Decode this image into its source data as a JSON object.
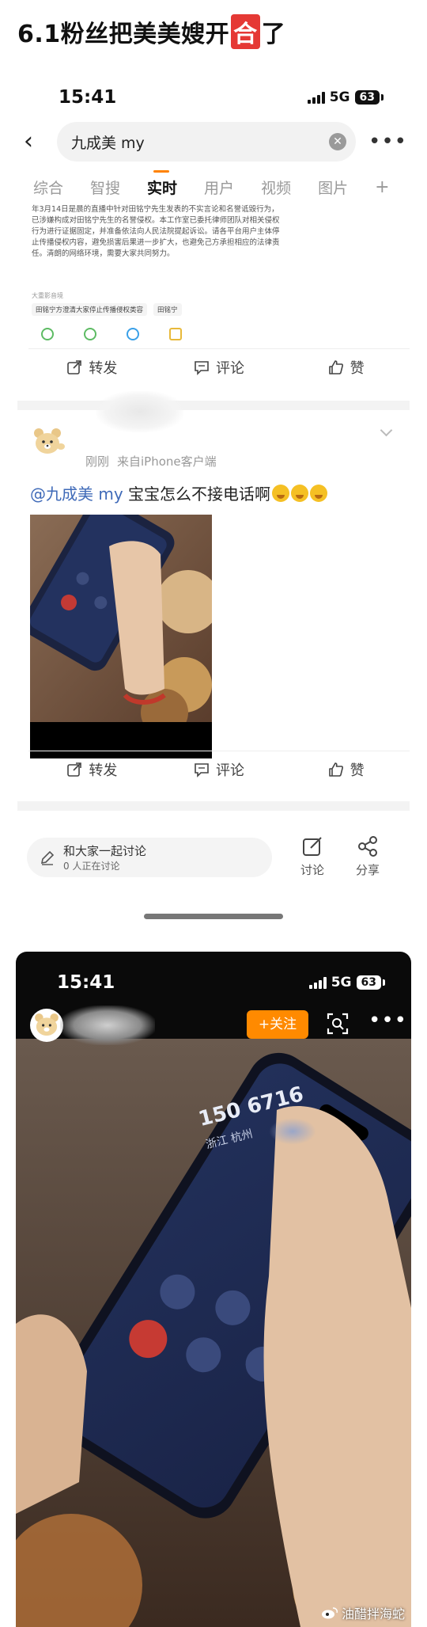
{
  "headline": {
    "before": "6.1粉丝把美美嫂开",
    "badge": "合",
    "after": "了"
  },
  "status": {
    "time": "15:41",
    "network": "5G",
    "battery": "63"
  },
  "search": {
    "query": "九成美 my"
  },
  "tabs": [
    "综合",
    "智搜",
    "实时",
    "用户",
    "视频",
    "图片"
  ],
  "tabs_active": "实时",
  "tab_add": "+",
  "quoted_article": {
    "text": "年3月14日是晨的直播中针对田铭宁先生发表的不实言论和名誉诋毁行为，已涉嫌构成对田铭宁先生的名誉侵权。本工作室已委托律师团队对相关侵权行为进行证据固定，并准备依法向人民法院提起诉讼。请各平台用户主体停止传播侵权内容，避免损害后果进一步扩大，也避免己方承担相应的法律责任。清朗的网络环境，需要大家共同努力。",
    "meta": "大重影音境",
    "tags": [
      "田铭宁方澄清大家停止传播侵权类容",
      "田铭宁"
    ]
  },
  "actions": {
    "repost": "转发",
    "comment": "评论",
    "like": "赞"
  },
  "post": {
    "time": "刚刚",
    "source": "来自iPhone客户端",
    "mention": "@九成美 my",
    "text": " 宝宝怎么不接电话啊"
  },
  "bottom": {
    "discuss_title": "和大家一起讨论",
    "discuss_sub": "0 人正在讨论",
    "discuss_btn": "讨论",
    "share_btn": "分享"
  },
  "shot2": {
    "follow": "+关注",
    "call_number": "150 6716",
    "call_location": "浙江 杭州"
  },
  "watermark": "油醋拌海蛇",
  "colors": {
    "accent": "#ff8200",
    "follow": "#ff8a00",
    "mention": "#3f6ab8",
    "badge": "#e53935"
  }
}
